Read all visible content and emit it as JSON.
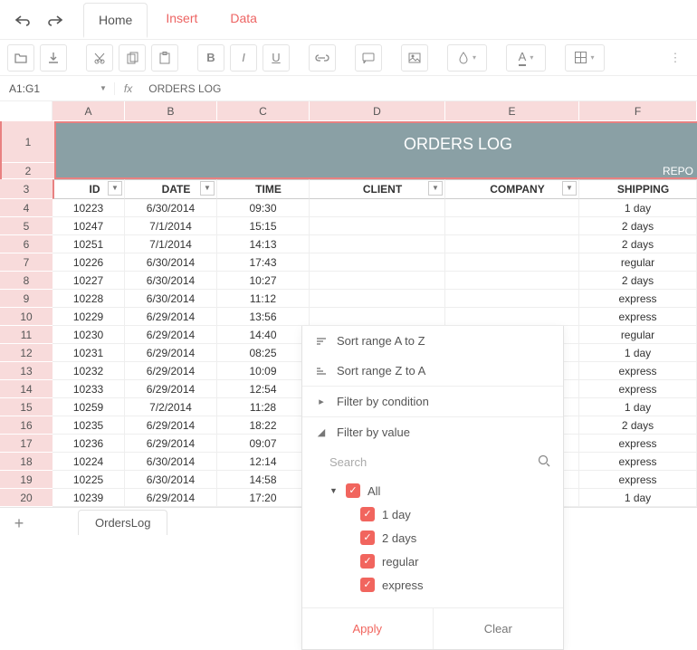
{
  "menu": {
    "tabs": [
      "Home",
      "Insert",
      "Data"
    ],
    "active": 0
  },
  "formula_bar": {
    "ref": "A1:G1",
    "fx_label": "fx",
    "value": "ORDERS LOG"
  },
  "columns": [
    "A",
    "B",
    "C",
    "D",
    "E",
    "F"
  ],
  "title_row": "ORDERS LOG",
  "row2_text": "REPO",
  "headers": {
    "id": "ID",
    "date": "DATE",
    "time": "TIME",
    "client": "CLIENT",
    "company": "COMPANY",
    "shipping": "SHIPPING"
  },
  "row_numbers": [
    "1",
    "2",
    "3",
    "4",
    "5",
    "6",
    "7",
    "8",
    "9",
    "10",
    "11",
    "12",
    "13",
    "14",
    "15",
    "16",
    "17",
    "18",
    "19",
    "20"
  ],
  "rows": [
    {
      "id": "10223",
      "date": "6/30/2014",
      "time": "09:30",
      "client": "",
      "company": "",
      "shipping": "1 day"
    },
    {
      "id": "10247",
      "date": "7/1/2014",
      "time": "15:15",
      "client": "",
      "company": "",
      "shipping": "2 days"
    },
    {
      "id": "10251",
      "date": "7/1/2014",
      "time": "14:13",
      "client": "",
      "company": "",
      "shipping": "2 days"
    },
    {
      "id": "10226",
      "date": "6/30/2014",
      "time": "17:43",
      "client": "",
      "company": "",
      "shipping": "regular"
    },
    {
      "id": "10227",
      "date": "6/30/2014",
      "time": "10:27",
      "client": "",
      "company": "",
      "shipping": "2 days"
    },
    {
      "id": "10228",
      "date": "6/30/2014",
      "time": "11:12",
      "client": "",
      "company": "",
      "shipping": "express"
    },
    {
      "id": "10229",
      "date": "6/29/2014",
      "time": "13:56",
      "client": "",
      "company": "",
      "shipping": "express"
    },
    {
      "id": "10230",
      "date": "6/29/2014",
      "time": "14:40",
      "client": "",
      "company": "",
      "shipping": "regular"
    },
    {
      "id": "10231",
      "date": "6/29/2014",
      "time": "08:25",
      "client": "",
      "company": "",
      "shipping": "1 day"
    },
    {
      "id": "10232",
      "date": "6/29/2014",
      "time": "10:09",
      "client": "",
      "company": "",
      "shipping": "express"
    },
    {
      "id": "10233",
      "date": "6/29/2014",
      "time": "12:54",
      "client": "",
      "company": "",
      "shipping": "express"
    },
    {
      "id": "10259",
      "date": "7/2/2014",
      "time": "11:28",
      "client": "",
      "company": "",
      "shipping": "1 day"
    },
    {
      "id": "10235",
      "date": "6/29/2014",
      "time": "18:22",
      "client": "",
      "company": "",
      "shipping": "2 days"
    },
    {
      "id": "10236",
      "date": "6/29/2014",
      "time": "09:07",
      "client": "",
      "company": "",
      "shipping": "express"
    },
    {
      "id": "10224",
      "date": "6/30/2014",
      "time": "12:14",
      "client": "",
      "company": "",
      "shipping": "express"
    },
    {
      "id": "10225",
      "date": "6/30/2014",
      "time": "14:58",
      "client": "",
      "company": "",
      "shipping": "express"
    },
    {
      "id": "10239",
      "date": "6/29/2014",
      "time": "17:20",
      "client": "",
      "company": "",
      "shipping": "1 day"
    }
  ],
  "sheet_tab": "OrdersLog",
  "filter_panel": {
    "sort_az": "Sort range A to Z",
    "sort_za": "Sort range Z to A",
    "by_condition": "Filter by condition",
    "by_value": "Filter by value",
    "search_placeholder": "Search",
    "all_label": "All",
    "options": [
      "1 day",
      "2 days",
      "regular",
      "express"
    ],
    "apply": "Apply",
    "clear": "Clear"
  }
}
